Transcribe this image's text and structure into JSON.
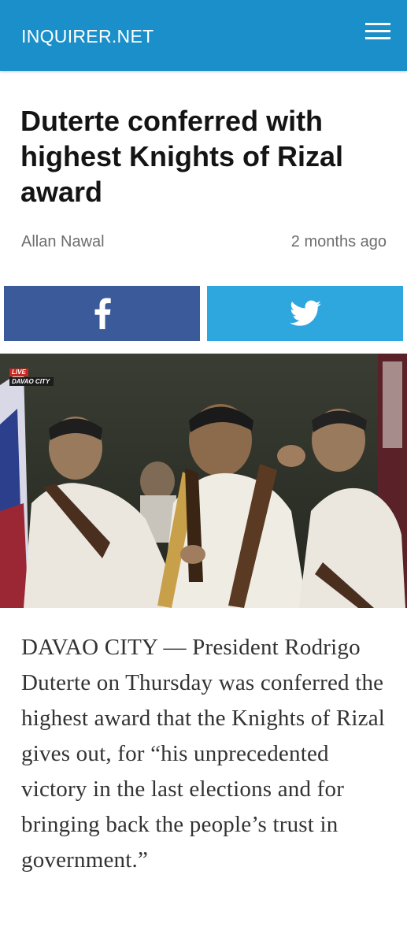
{
  "header": {
    "brand": "INQUIRER.NET",
    "menu_icon": "hamburger-menu-icon",
    "background_color": "#1a8fc9"
  },
  "article": {
    "headline": "Duterte conferred with highest Knights of Rizal award",
    "author": "Allan Nawal",
    "time_ago": "2 months ago",
    "body": "DAVAO CITY — President Rodrigo Duterte on Thursday was conferred the highest award that the Knights of Rizal gives out, for “his unprecedented victory in the last elections and for bringing back the people’s trust in government.”"
  },
  "share": {
    "facebook": {
      "icon": "facebook-icon",
      "color": "#3b5a9a"
    },
    "twitter": {
      "icon": "twitter-icon",
      "color": "#2ea7df"
    }
  },
  "photo": {
    "live_label": "LIVE",
    "location_label": "DAVAO CITY"
  }
}
